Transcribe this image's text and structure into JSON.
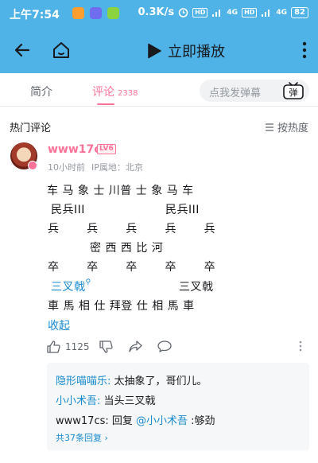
{
  "status_bar": {
    "time": "上午7:54",
    "network_speed": "0.3K/s",
    "signal_label_1": "4G",
    "signal_label_2": "4G",
    "hd_label": "HD",
    "battery": "82"
  },
  "header": {
    "play_label": "立即播放",
    "icons": [
      "back-arrow-icon",
      "home-icon",
      "play-icon",
      "more-vertical-icon"
    ]
  },
  "tabs": {
    "intro_label": "简介",
    "comments_label": "评论",
    "comments_count": "2338",
    "danmaku_placeholder": "点我发弹幕",
    "danmaku_button_label": "弹"
  },
  "section": {
    "title": "热门评论",
    "sort_label": "按热度"
  },
  "comment": {
    "username": "www17cs",
    "level": "LV6",
    "time": "10小时前",
    "ip_location": "IP属地：北京",
    "lines": {
      "l1": "车 马 象 士 川普 士 象 马 车",
      "l2": "民兵III",
      "l2b": "民兵III",
      "l3": "兵       兵       兵       兵       兵",
      "l4": "密 西 西 比 河",
      "l5": "卒       卒       卒       卒       卒",
      "l6": "三叉戟",
      "l6b": "三叉戟",
      "l7": "車 馬 相 仕 拜登 仕 相 馬 車"
    },
    "collapse_label": "收起",
    "like_count": "1125"
  },
  "replies": [
    {
      "user": "隐形喵喵乐:",
      "text": " 太抽象了，哥们儿。"
    },
    {
      "user": "小小术吾:",
      "text": " 当头三叉戟"
    },
    {
      "user_plain": "www17cs:",
      "text_pre": " 回复 ",
      "mention": "@小小术吾",
      "text_post": " :够劲"
    }
  ],
  "replies_more": "共37条回复",
  "colors": {
    "header_bg": "#4fb3e8",
    "accent_pink": "#fb7299",
    "link_blue": "#178bcf"
  }
}
